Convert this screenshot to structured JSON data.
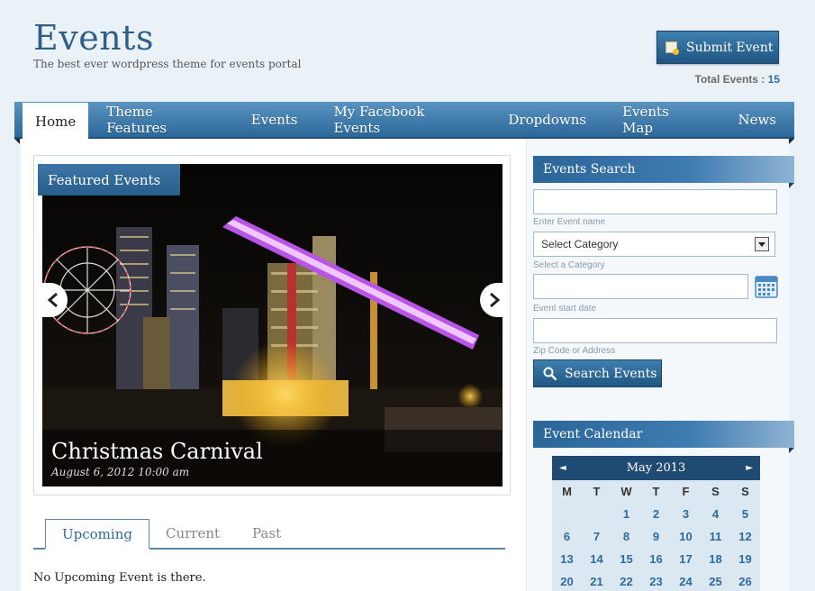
{
  "header": {
    "title": "Events",
    "tagline": "The best ever wordpress theme for events portal",
    "submit_label": "Submit Event",
    "total_label": "Total Events : ",
    "total_count": "15"
  },
  "nav": {
    "items": [
      "Home",
      "Theme Features",
      "Events",
      "My Facebook Events",
      "Dropdowns",
      "Events Map",
      "News"
    ]
  },
  "slider": {
    "label": "Featured Events",
    "event_title": "Christmas Carnival",
    "event_date": "August 6, 2012 10:00 am"
  },
  "tabs": {
    "items": [
      "Upcoming",
      "Current",
      "Past"
    ],
    "empty_message": "No Upcoming Event is there."
  },
  "sidebar": {
    "search": {
      "title": "Events Search",
      "name_hint": "Enter Event name",
      "category_value": "Select Category",
      "category_hint": "Select a Category",
      "date_hint": "Event start date",
      "zip_hint": "Zip Code or Address",
      "button": "Search Events"
    },
    "calendar": {
      "title": "Event Calendar",
      "month": "May 2013",
      "prev": "◄",
      "next": "►",
      "weekdays": [
        "M",
        "T",
        "W",
        "T",
        "F",
        "S",
        "S"
      ],
      "days": [
        "",
        "",
        "1",
        "2",
        "3",
        "4",
        "5",
        "6",
        "7",
        "8",
        "9",
        "10",
        "11",
        "12",
        "13",
        "14",
        "15",
        "16",
        "17",
        "18",
        "19",
        "20",
        "21",
        "22",
        "23",
        "24",
        "25",
        "26"
      ]
    }
  },
  "colors": {
    "brand": "#2d5f8a",
    "nav_gradient_top": "#5a94c1",
    "nav_gradient_bottom": "#2b6799",
    "accent_link": "#2d6aa0"
  }
}
